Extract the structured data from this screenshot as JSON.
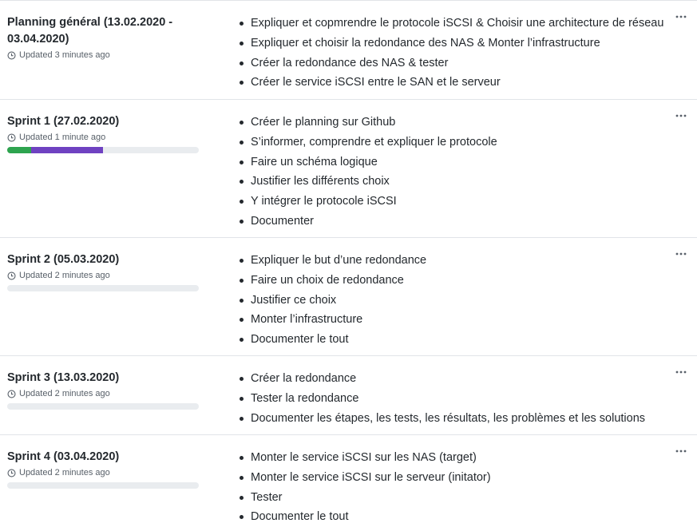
{
  "colors": {
    "progress_done": "#2ea44f",
    "progress_in_progress": "#6f42c1",
    "progress_track": "#e9ecef"
  },
  "icons": {
    "updated": "clock-icon",
    "menu": "kebab-more-icon"
  },
  "milestones": [
    {
      "title": "Planning général (13.02.2020 - 03.04.2020)",
      "updated": "Updated 3 minutes ago",
      "has_progress": false,
      "progress": {
        "done": 0,
        "in_progress": 0
      },
      "tasks": [
        "Expliquer et copmrendre le protocole iSCSI & Choisir une architecture de réseau",
        "Expliquer et choisir la redondance des NAS & Monter l’infrastructure",
        "Créer la redondance des NAS & tester",
        "Créer le service iSCSI entre le SAN et le serveur"
      ]
    },
    {
      "title": "Sprint 1 (27.02.2020)",
      "updated": "Updated 1 minute ago",
      "has_progress": true,
      "progress": {
        "done": 0.125,
        "in_progress": 0.375
      },
      "tasks": [
        "Créer le planning sur Github",
        "S’informer, comprendre et expliquer le protocole",
        "Faire un schéma logique",
        "Justifier les différents choix",
        "Y intégrer le protocole iSCSI",
        "Documenter"
      ]
    },
    {
      "title": "Sprint 2 (05.03.2020)",
      "updated": "Updated 2 minutes ago",
      "has_progress": true,
      "progress": {
        "done": 0,
        "in_progress": 0
      },
      "tasks": [
        "Expliquer le but d’une redondance",
        "Faire un choix de redondance",
        "Justifier ce choix",
        "Monter l’infrastructure",
        "Documenter le tout"
      ]
    },
    {
      "title": "Sprint 3 (13.03.2020)",
      "updated": "Updated 2 minutes ago",
      "has_progress": true,
      "progress": {
        "done": 0,
        "in_progress": 0
      },
      "tasks": [
        "Créer la redondance",
        "Tester la redondance",
        "Documenter les étapes, les tests, les résultats, les problèmes et les solutions"
      ]
    },
    {
      "title": "Sprint 4 (03.04.2020)",
      "updated": "Updated 2 minutes ago",
      "has_progress": true,
      "progress": {
        "done": 0,
        "in_progress": 0
      },
      "tasks": [
        "Monter le service iSCSI sur les NAS (target)",
        "Monter le service iSCSI sur le serveur (initator)",
        "Tester",
        "Documenter le tout"
      ]
    }
  ]
}
